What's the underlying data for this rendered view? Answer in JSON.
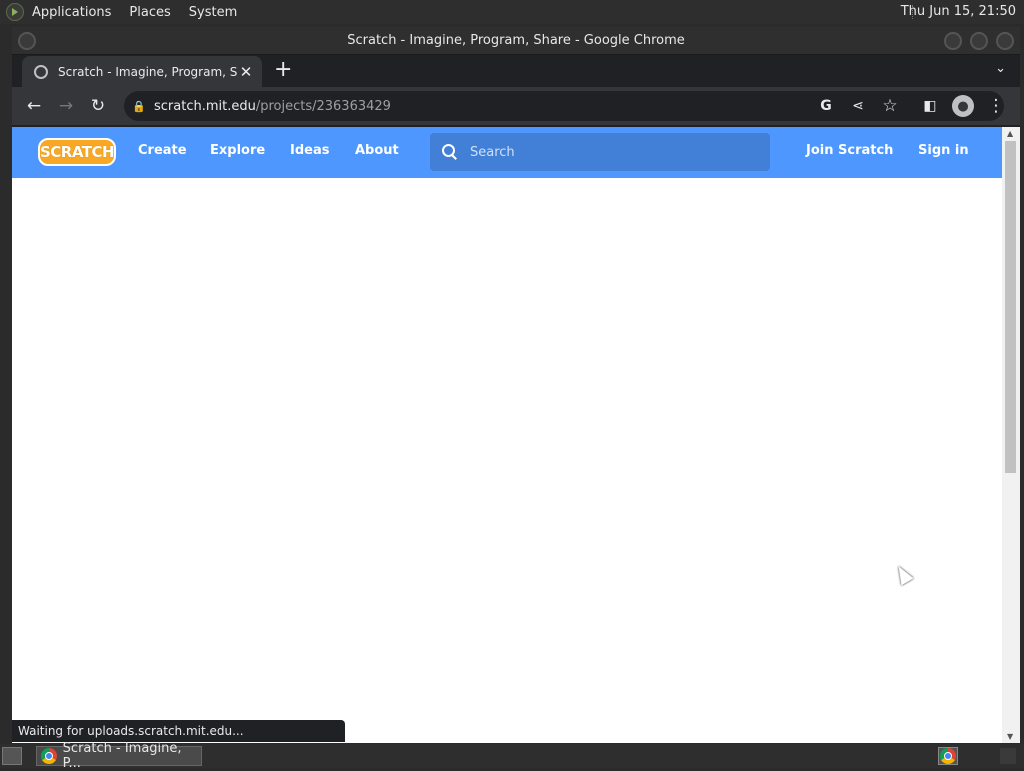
{
  "top_panel": {
    "menus": [
      "Applications",
      "Places",
      "System"
    ],
    "clock": "Thu Jun 15, 21:50"
  },
  "window": {
    "title": "Scratch - Imagine, Program, Share - Google Chrome"
  },
  "tabs": [
    {
      "title": "Scratch - Imagine, Program, Sh",
      "favicon": "globe-icon"
    }
  ],
  "toolbar": {
    "url_domain": "scratch.mit.edu",
    "url_path": "/projects/236363429"
  },
  "scratch": {
    "logo_text": "SCRATCH",
    "nav": [
      "Create",
      "Explore",
      "Ideas",
      "About"
    ],
    "search_placeholder": "Search",
    "join": "Join Scratch",
    "signin": "Sign in",
    "brand_color": "#4d97ff"
  },
  "status_bar": "Waiting for uploads.scratch.mit.edu...",
  "taskbar": {
    "task_label": "Scratch - Imagine, P..."
  }
}
